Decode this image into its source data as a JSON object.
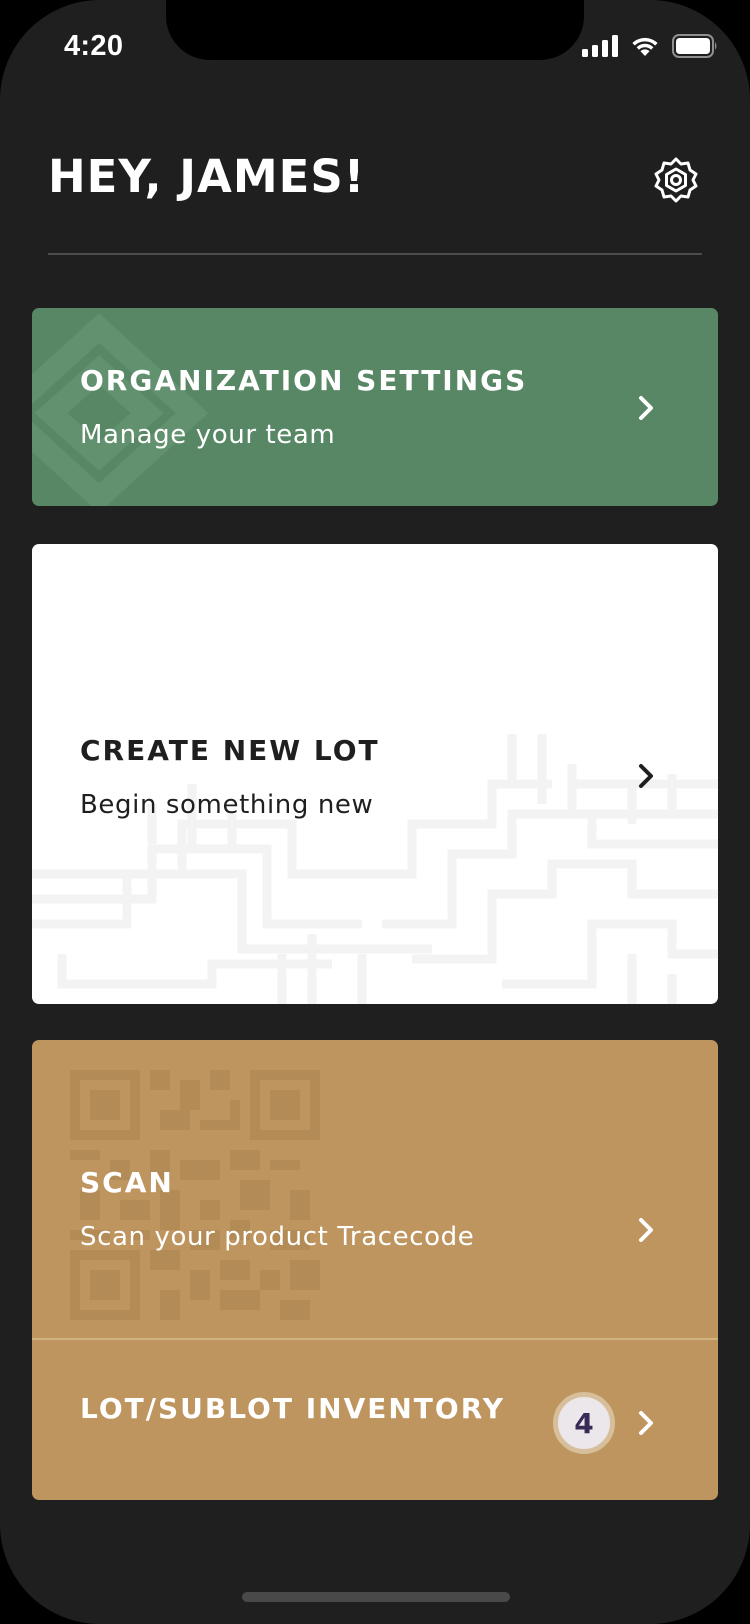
{
  "status_bar": {
    "time": "4:20"
  },
  "header": {
    "greeting": "HEY, JAMES!"
  },
  "cards": {
    "organization": {
      "title": "ORGANIZATION SETTINGS",
      "subtitle": "Manage your team"
    },
    "create_lot": {
      "title": "CREATE NEW LOT",
      "subtitle": "Begin something new"
    },
    "scan": {
      "title": "SCAN",
      "subtitle": "Scan your product Tracecode"
    },
    "inventory": {
      "title": "LOT/SUBLOT INVENTORY",
      "badge_count": "4"
    }
  },
  "colors": {
    "background": "#201f1f",
    "organization_card": "#578765",
    "create_card": "#ffffff",
    "scan_card": "#be955f",
    "badge_text": "#3a2a58"
  },
  "icons": {
    "settings": "gear-icon",
    "chevron": "chevron-right-icon"
  }
}
